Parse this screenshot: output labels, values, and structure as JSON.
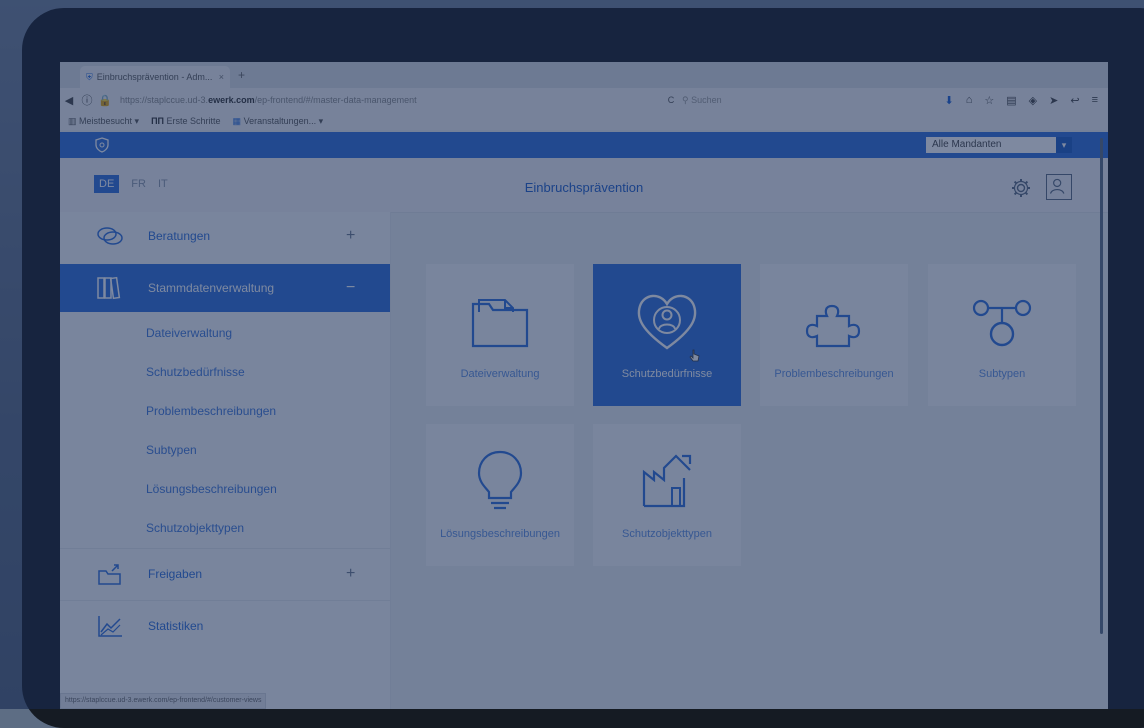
{
  "browser": {
    "tab_title": "Einbruchsprävention - Adm...",
    "tab_close": "×",
    "new_tab": "+",
    "url_prefix": "https://staplccue.ud-3.",
    "url_domain": "ewerk.com",
    "url_suffix": "/ep-frontend/#/master-data-management",
    "reload": "C",
    "search_placeholder": "Suchen",
    "bookmarks": [
      "Meistbesucht ▾",
      "Erste Schritte",
      "Veranstaltungen... ▾"
    ]
  },
  "app": {
    "mandant_select": "Alle Mandanten",
    "languages": {
      "de": "DE",
      "fr": "FR",
      "it": "IT"
    },
    "page_title": "Einbruchsprävention"
  },
  "sidebar": {
    "beratungen": {
      "label": "Beratungen",
      "sign": "+"
    },
    "stammdaten": {
      "label": "Stammdatenverwaltung",
      "sign": "−"
    },
    "subitems": [
      "Dateiverwaltung",
      "Schutzbedürfnisse",
      "Problembeschreibungen",
      "Subtypen",
      "Lösungsbeschreibungen",
      "Schutzobjekttypen"
    ],
    "freigaben": {
      "label": "Freigaben",
      "sign": "+"
    },
    "statistiken": {
      "label": "Statistiken"
    }
  },
  "tiles": [
    {
      "label": "Dateiverwaltung",
      "icon": "folder-icon"
    },
    {
      "label": "Schutzbedürfnisse",
      "icon": "heart-person-icon"
    },
    {
      "label": "Problembeschreibungen",
      "icon": "puzzle-icon"
    },
    {
      "label": "Subtypen",
      "icon": "subtypes-icon"
    },
    {
      "label": "Lösungsbeschreibungen",
      "icon": "lightbulb-icon"
    },
    {
      "label": "Schutzobjekttypen",
      "icon": "building-icon"
    }
  ],
  "status_url": "https://staplccue.ud-3.ewerk.com/ep-frontend/#/customer-views",
  "colors": {
    "primary": "#2e6fd8",
    "overlay": "#192d55"
  }
}
